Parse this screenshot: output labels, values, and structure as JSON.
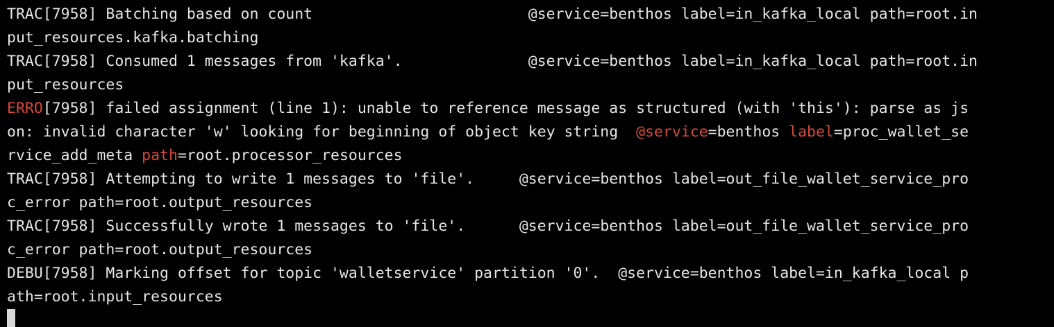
{
  "terminal": {
    "lines": [
      {
        "level": "TRAC",
        "rest": "[7958] Batching based on count                        @service=benthos label=in_kafka_local path=root.in"
      },
      {
        "text": "put_resources.kafka.batching"
      },
      {
        "level": "TRAC",
        "rest": "[7958] Consumed 1 messages from 'kafka'.              @service=benthos label=in_kafka_local path=root.in"
      },
      {
        "text": "put_resources"
      },
      {
        "level": "ERRO",
        "rest": "[7958] failed assignment (line 1): unable to reference message as structured (with 'this'): parse as js"
      },
      {
        "prefix": "on: invalid character 'w' looking for beginning of object key string  ",
        "k1": "@service",
        "v1": "=benthos ",
        "k2": "label",
        "v2": "=proc_wallet_se"
      },
      {
        "prefix": "rvice_add_meta ",
        "k3": "path",
        "v3": "=root.processor_resources"
      },
      {
        "level": "TRAC",
        "rest": "[7958] Attempting to write 1 messages to 'file'.     @service=benthos label=out_file_wallet_service_pro"
      },
      {
        "text": "c_error path=root.output_resources"
      },
      {
        "level": "TRAC",
        "rest": "[7958] Successfully wrote 1 messages to 'file'.      @service=benthos label=out_file_wallet_service_pro"
      },
      {
        "text": "c_error path=root.output_resources"
      },
      {
        "level": "DEBU",
        "rest": "[7958] Marking offset for topic 'walletservice' partition '0'.  @service=benthos label=in_kafka_local p"
      },
      {
        "text": "ath=root.input_resources"
      }
    ],
    "colors": {
      "background": "#000000",
      "foreground": "#e6e6e6",
      "error": "#d9483b",
      "cursor": "#d8d8d8"
    }
  }
}
